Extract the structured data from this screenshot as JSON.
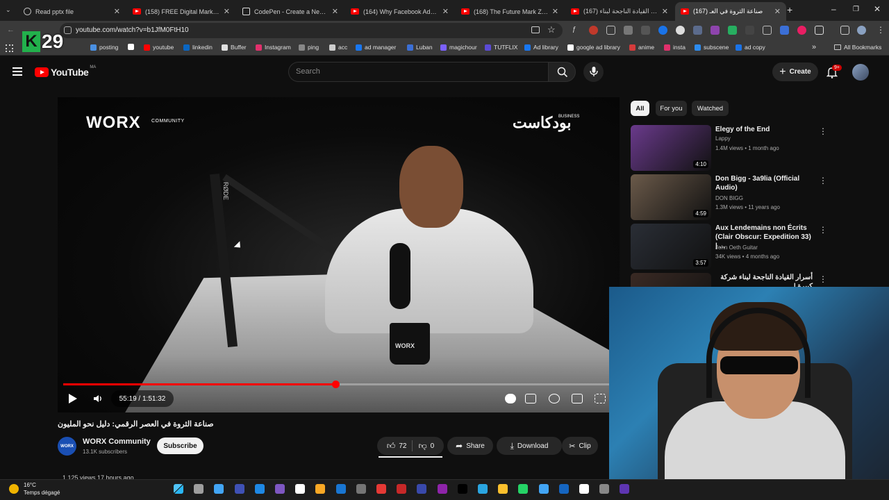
{
  "browser": {
    "tabs": [
      {
        "label": "Read pptx file",
        "icon": "openai-icon",
        "active": false
      },
      {
        "label": "(158) FREE Digital Marketing",
        "icon": "youtube-icon",
        "active": false
      },
      {
        "label": "CodePen - Create a New Pen",
        "icon": "codepen-icon",
        "active": false
      },
      {
        "label": "(164) Why Facebook Ads Are",
        "icon": "youtube-icon",
        "active": false
      },
      {
        "label": "(168) The Future Mark Zucker",
        "icon": "youtube-icon",
        "active": false
      },
      {
        "label": "(167) أسرار القيادة الناجحة لبناء",
        "icon": "youtube-icon",
        "active": false
      },
      {
        "label": "(167) صناعة الثروة في العـ",
        "icon": "youtube-icon",
        "active": true
      }
    ],
    "new_tab": "+",
    "window_controls": [
      "–",
      "❐",
      "✕"
    ],
    "url": "youtube.com/watch?v=b1JfM0FtH10",
    "bookmarks": [
      {
        "label": "posting",
        "color": "#4a90e2"
      },
      {
        "label": "",
        "color": "#ffffff"
      },
      {
        "label": "youtube",
        "color": "#ff0000"
      },
      {
        "label": "linkedin",
        "color": "#0a66c2"
      },
      {
        "label": "Buffer",
        "color": "#e0e0e0"
      },
      {
        "label": "Instagram",
        "color": "#e1306c"
      },
      {
        "label": "ping",
        "color": "#888888"
      },
      {
        "label": "acc",
        "color": "#cccccc"
      },
      {
        "label": "ad manager",
        "color": "#1877f2"
      },
      {
        "label": "Luban",
        "color": "#3b6fd6"
      },
      {
        "label": "magichour",
        "color": "#7b61ff"
      },
      {
        "label": "TUTFLIX",
        "color": "#5b4bd6"
      },
      {
        "label": "Ad library",
        "color": "#1877f2"
      },
      {
        "label": "google ad library",
        "color": "#ffffff"
      },
      {
        "label": "anime",
        "color": "#d43b3b"
      },
      {
        "label": "insta",
        "color": "#e1306c"
      },
      {
        "label": "subscene",
        "color": "#2d8cf0"
      },
      {
        "label": "ad copy",
        "color": "#1a73e8"
      }
    ],
    "more_bookmarks": "»",
    "all_bookmarks": "All Bookmarks"
  },
  "overlay": {
    "k": "K",
    "number": "29"
  },
  "youtube": {
    "logo_text": "YouTube",
    "country": "MA",
    "search_placeholder": "Search",
    "create_label": "Create",
    "notifications_badge": "9+"
  },
  "video": {
    "brand_left": "WORX",
    "brand_left_sub": "COMMUNITY",
    "brand_right": "بودكاست",
    "brand_right_sub": "BUSINESS",
    "mic_brand": "RØDE",
    "mug_text": "WORX",
    "time": "55:19 / 1:51:32",
    "progress": 0.499,
    "title": "صناعة الثروة في العصر الرقمي: دليل نحو المليون",
    "channel": "WORX Community",
    "channel_avatar_text": "WORX",
    "subscribers": "13.1K subscribers",
    "subscribe_label": "Subscribe",
    "likes": "72",
    "dislikes": "0",
    "share_label": "Share",
    "download_label": "Download",
    "clip_label": "Clip",
    "views_line": "1,125 views  17 hours ago"
  },
  "chips": [
    "All",
    "For you",
    "Watched"
  ],
  "recommendations": [
    {
      "title": "Elegy of the End",
      "channel": "Lappy",
      "meta": "1.4M views • 1 month ago",
      "duration": "4:10",
      "color": "#6a3a8c"
    },
    {
      "title": "Don Bigg - 3a9lia (Official Audio)",
      "channel": "DON BIGG",
      "meta": "1.3M views • 11 years ago",
      "duration": "4:59",
      "color": "#6b5a4a"
    },
    {
      "title": "Aux Lendemains non Écrits (Clair Obscur: Expedition 33) | ...",
      "channel": "John Oeth Guitar",
      "meta": "34K views • 4 months ago",
      "duration": "3:57",
      "color": "#2a2e36"
    },
    {
      "title": "أسرار القيادة الناجحة لبناء شركة كبيرة |",
      "channel": "",
      "meta": "",
      "duration": "",
      "color": "#3a2a24"
    }
  ],
  "taskbar": {
    "temperature": "16°C",
    "weather": "Temps dégagé"
  }
}
